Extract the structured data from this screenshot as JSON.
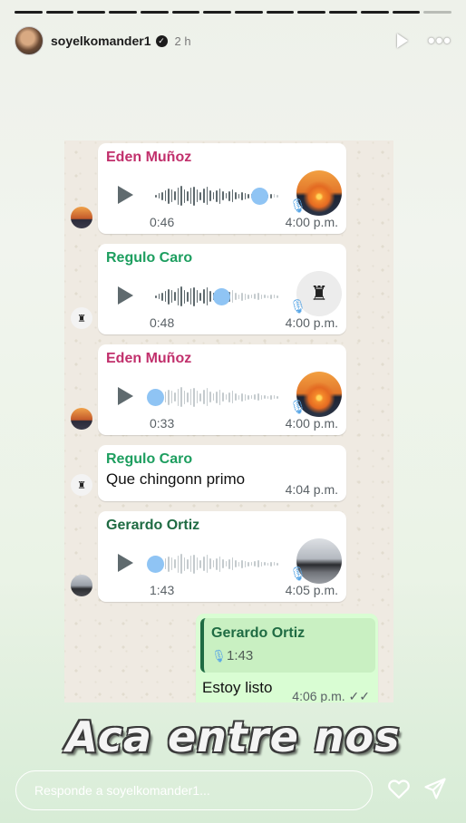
{
  "story": {
    "username": "soyelkomander1",
    "verified_mark": "✓",
    "time_ago": "2 h",
    "segments": 14,
    "caption": "Aca entre nos",
    "reply_placeholder": "Responde a soyelkomander1..."
  },
  "icons": {
    "top": [
      "play-icon",
      "more-icon"
    ],
    "bottom": [
      "heart-icon",
      "send-icon"
    ]
  },
  "messages": [
    {
      "sender": "Eden Muñoz",
      "color": "#c1306c",
      "type": "audio",
      "duration": "0:46",
      "time": "4:00 p.m.",
      "progress": 0.94,
      "thumb": "sunset",
      "pic": "sunset"
    },
    {
      "sender": "Regulo Caro",
      "color": "#1d9e5f",
      "type": "audio",
      "duration": "0:48",
      "time": "4:00 p.m.",
      "progress": 0.6,
      "thumb": "logo",
      "pic": "logo"
    },
    {
      "sender": "Eden Muñoz",
      "color": "#c1306c",
      "type": "audio",
      "duration": "0:33",
      "time": "4:00 p.m.",
      "progress": 0.0,
      "thumb": "sunset",
      "pic": "sunset"
    },
    {
      "sender": "Regulo Caro",
      "color": "#1d9e5f",
      "type": "text",
      "text": "Que chingonn primo",
      "time": "4:04 p.m.",
      "pic": "logo"
    },
    {
      "sender": "Gerardo Ortiz",
      "color": "#1f6b43",
      "type": "audio",
      "duration": "1:43",
      "time": "4:05 p.m.",
      "progress": 0.0,
      "thumb": "car",
      "pic": "car"
    }
  ],
  "outgoing": {
    "quote_name": "Gerardo Ortiz",
    "quote_duration": "1:43",
    "text": "Estoy listo",
    "time": "4:06 p.m."
  }
}
